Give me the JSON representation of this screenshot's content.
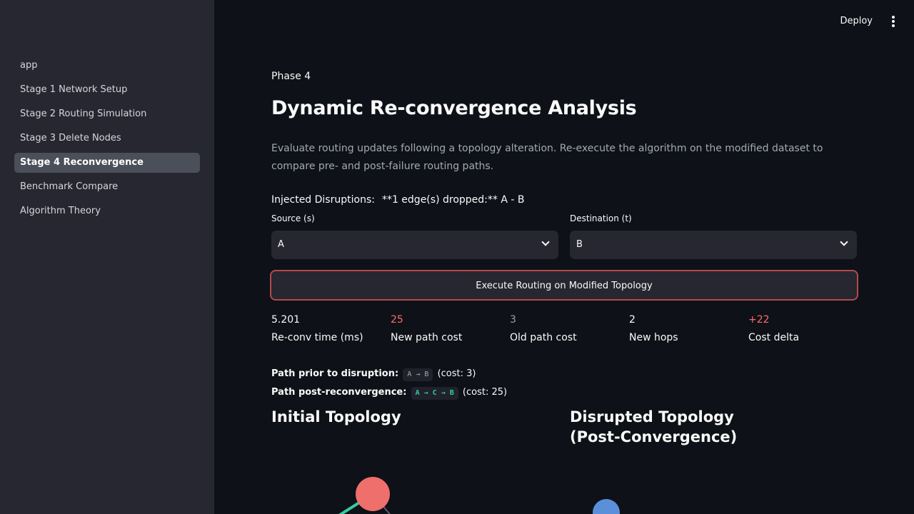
{
  "topbar": {
    "deploy_label": "Deploy",
    "menu_icon": "kebab-menu-icon"
  },
  "sidebar": {
    "items": [
      {
        "label": "app",
        "active": false
      },
      {
        "label": "Stage 1 Network Setup",
        "active": false
      },
      {
        "label": "Stage 2 Routing Simulation",
        "active": false
      },
      {
        "label": "Stage 3 Delete Nodes",
        "active": false
      },
      {
        "label": "Stage 4 Reconvergence",
        "active": true
      },
      {
        "label": "Benchmark Compare",
        "active": false
      },
      {
        "label": "Algorithm Theory",
        "active": false
      }
    ]
  },
  "main": {
    "phase": "Phase 4",
    "title": "Dynamic Re-convergence Analysis",
    "description": "Evaluate routing updates following a topology alteration. Re-execute the algorithm on the modified dataset to compare pre- and post-failure routing paths.",
    "injected_label": "Injected Disruptions:",
    "injected_value": "**1 edge(s) dropped:** A - B",
    "source": {
      "label": "Source (s)",
      "value": "A"
    },
    "destination": {
      "label": "Destination (t)",
      "value": "B"
    },
    "execute_button": "Execute Routing on Modified Topology",
    "metrics": [
      {
        "value": "5.201",
        "label": "Re-conv time (ms)",
        "color": "#fafafa"
      },
      {
        "value": "25",
        "label": "New path cost",
        "color": "#ff6b6b"
      },
      {
        "value": "3",
        "label": "Old path cost",
        "color": "#9a9ea8"
      },
      {
        "value": "2",
        "label": "New hops",
        "color": "#fafafa"
      },
      {
        "value": "+22",
        "label": "Cost delta",
        "color": "#ff6b6b"
      }
    ],
    "path_prior": {
      "label": "Path prior to disruption:",
      "path": "A → B",
      "cost": "(cost: 3)"
    },
    "path_post": {
      "label": "Path post-reconvergence:",
      "path": "A → C → B",
      "cost": "(cost: 25)"
    },
    "initial_topology_title": "Initial Topology",
    "disrupted_topology_title": "Disrupted Topology (Post-Convergence)",
    "colors": {
      "accent_red": "#ff6b6b",
      "path_green": "#36c9a2",
      "node_red": "#ef6f6c",
      "node_blue": "#5b8fd9",
      "button_border": "#b34a4d"
    }
  }
}
